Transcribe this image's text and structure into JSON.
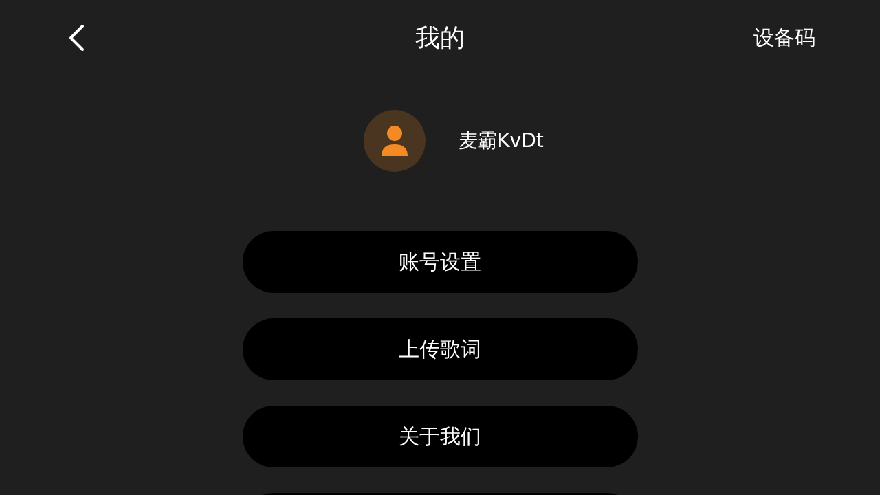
{
  "header": {
    "title": "我的",
    "action": "设备码"
  },
  "profile": {
    "name": "麦霸KvDt"
  },
  "menu": [
    {
      "label": "账号设置"
    },
    {
      "label": "上传歌词"
    },
    {
      "label": "关于我们"
    }
  ],
  "more_below": true
}
